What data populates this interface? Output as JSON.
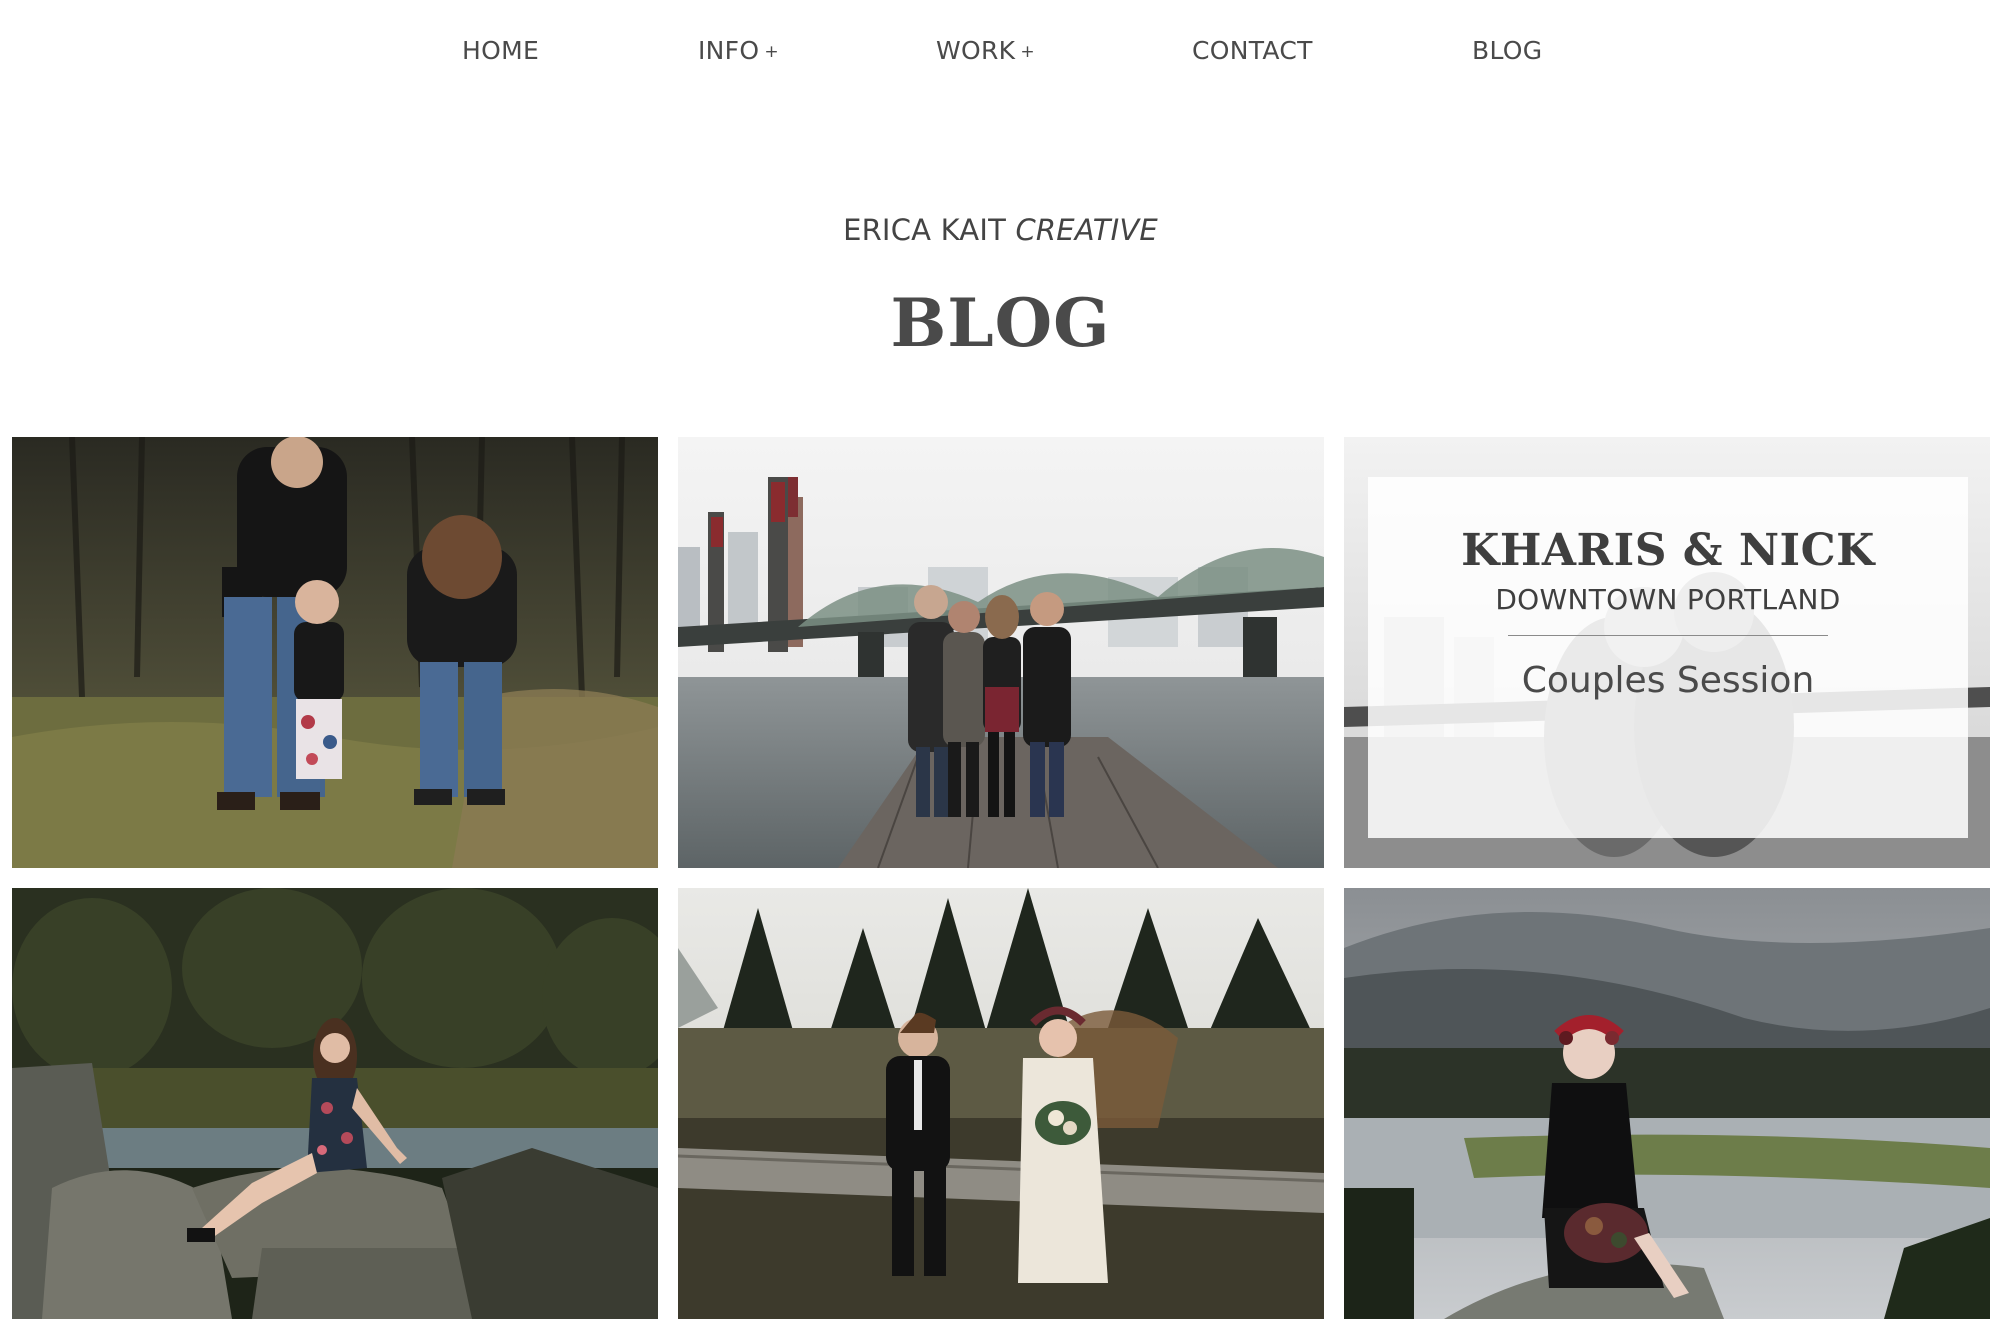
{
  "nav": {
    "home": "HOME",
    "info": "INFO",
    "work": "WORK",
    "plus": "+",
    "contact": "CONTACT",
    "blog": "BLOG"
  },
  "header": {
    "brand_main": "ERICA KAIT",
    "brand_italic": "CREATIVE",
    "title": "BLOG"
  },
  "posts": [
    {
      "photo": "family-photo-forest",
      "kind": "image"
    },
    {
      "photo": "family-photo-bridge-dock",
      "kind": "image"
    },
    {
      "photo": "couple-photo-city",
      "kind": "title-card",
      "card_title": "KHARIS & NICK",
      "card_subtitle": "DOWNTOWN PORTLAND",
      "card_type": "Couples Session"
    },
    {
      "photo": "senior-portrait-river-rocks",
      "kind": "image"
    },
    {
      "photo": "wedding-couple-on-log",
      "kind": "image"
    },
    {
      "photo": "portrait-flower-crown-mountains",
      "kind": "image"
    }
  ]
}
